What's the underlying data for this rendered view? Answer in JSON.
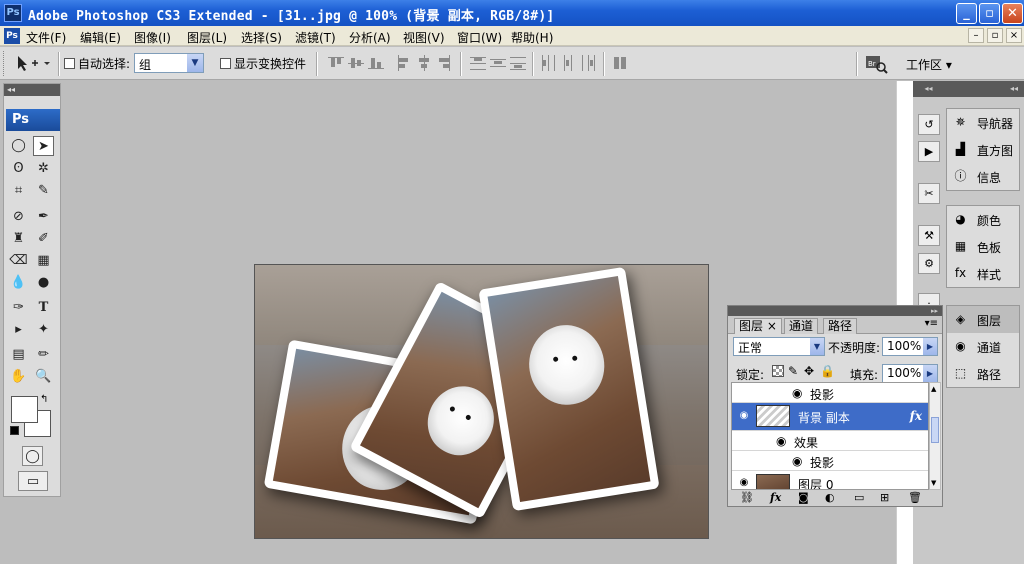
{
  "window": {
    "title": "Adobe Photoshop CS3 Extended - [31..jpg @ 100% (背景 副本, RGB/8#)]",
    "app_badge": "Ps",
    "minimize": "_",
    "maximize": "▫",
    "close": "✕"
  },
  "menu": {
    "doc_badge": "Ps",
    "items": [
      "文件(F)",
      "编辑(E)",
      "图像(I)",
      "图层(L)",
      "选择(S)",
      "滤镜(T)",
      "分析(A)",
      "视图(V)",
      "窗口(W)",
      "帮助(H)"
    ],
    "doc_minimize": "–",
    "doc_restore": "▫",
    "doc_close": "×"
  },
  "options": {
    "auto_select_label": "自动选择:",
    "auto_select_value": "组",
    "show_transform_label": "显示变换控件",
    "workspace_label": "工作区 ▾"
  },
  "toolbox": {
    "logo": "Ps"
  },
  "right_dock": {
    "items": [
      {
        "icon": "history-icon",
        "label": "导航器"
      },
      {
        "icon": "histogram-icon",
        "label": "直方图"
      },
      {
        "icon": "info-icon",
        "label": "信息"
      },
      {
        "icon": "color-icon",
        "label": "颜色"
      },
      {
        "icon": "swatches-icon",
        "label": "色板"
      },
      {
        "icon": "styles-icon",
        "label": "样式"
      },
      {
        "icon": "layers-icon",
        "label": "图层"
      },
      {
        "icon": "channels-icon",
        "label": "通道"
      },
      {
        "icon": "paths-icon",
        "label": "路径"
      }
    ]
  },
  "layers_panel": {
    "tabs": [
      "图层 ×",
      "通道",
      "路径"
    ],
    "blend_mode": "正常",
    "opacity_label": "不透明度:",
    "opacity_value": "100%",
    "lock_label": "锁定:",
    "fill_label": "填充:",
    "fill_value": "100%",
    "rows": [
      {
        "type": "effect",
        "label": "投影"
      },
      {
        "type": "layer",
        "label": "背景 副本",
        "fx": "fx",
        "selected": true
      },
      {
        "type": "effects",
        "label": "效果"
      },
      {
        "type": "effect",
        "label": "投影"
      },
      {
        "type": "layer",
        "label": "图层 0"
      }
    ]
  },
  "colors": {
    "title_bar": "#1d5fd4",
    "menu_bg": "#ece9d8",
    "panel_bg": "#dcdcdc",
    "selection": "#3e6cc8",
    "canvas_bg": "#bdbdbd"
  }
}
